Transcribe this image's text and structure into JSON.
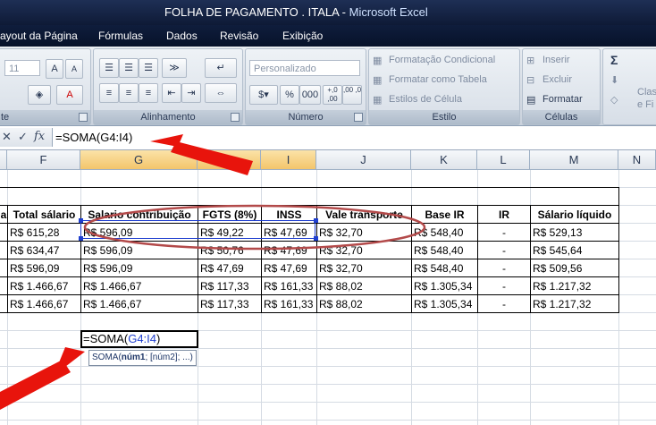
{
  "window": {
    "title": "FOLHA DE PAGAMENTO  . ITALA - ",
    "app": "Microsoft Excel"
  },
  "menu": [
    "ayout da Página",
    "Fórmulas",
    "Dados",
    "Revisão",
    "Exibição"
  ],
  "ribbon": {
    "font_group": {
      "label": "te",
      "size": "11",
      "grow": "A",
      "shrink": "A",
      "color_a": "A"
    },
    "alignment_group": {
      "label": "Alinhamento"
    },
    "number_group": {
      "label": "Número",
      "format": "Personalizado",
      "dec_inc": "+,0 ,00",
      "dec_dec": ",00 ,0"
    },
    "styles_group": {
      "label": "Estilo",
      "conditional": "Formatação Condicional",
      "table": "Formatar como Tabela",
      "cell_styles": "Estilos de Célula"
    },
    "cells_group": {
      "label": "Células",
      "insert": "Inserir",
      "delete": "Excluir",
      "format": "Formatar"
    },
    "editing_group": {
      "sigma": "Σ",
      "class": "Clas",
      "e_fi": "e Fi"
    }
  },
  "formula_bar": {
    "cancel": "✕",
    "enter": "✓",
    "fx": "fx",
    "formula": "=SOMA(G4:I4)"
  },
  "columns": [
    "F",
    "G",
    "H",
    "I",
    "J",
    "K",
    "L",
    "M",
    "N"
  ],
  "table": {
    "headers": [
      "a",
      "Total sálario",
      "Salario contribuição",
      "FGTS (8%)",
      "INSS",
      "Vale transporte",
      "Base IR",
      "IR",
      "Sálario líquido"
    ],
    "rows": [
      [
        "R$ 615,28",
        "R$ 596,09",
        "R$ 49,22",
        "R$ 47,69",
        "R$ 32,70",
        "R$ 548,40",
        "-",
        "R$ 529,13"
      ],
      [
        "R$ 634,47",
        "R$ 596,09",
        "R$ 50,76",
        "R$ 47,69",
        "R$ 32,70",
        "R$ 548,40",
        "-",
        "R$ 545,64"
      ],
      [
        "R$ 596,09",
        "R$ 596,09",
        "R$ 47,69",
        "R$ 47,69",
        "R$ 32,70",
        "R$ 548,40",
        "-",
        "R$ 509,56"
      ],
      [
        "R$ 1.466,67",
        "R$ 1.466,67",
        "R$ 117,33",
        "R$ 161,33",
        "R$ 88,02",
        "R$ 1.305,34",
        "-",
        "R$ 1.217,32"
      ],
      [
        "R$ 1.466,67",
        "R$ 1.466,67",
        "R$ 117,33",
        "R$ 161,33",
        "R$ 88,02",
        "R$ 1.305,34",
        "-",
        "R$ 1.217,32"
      ]
    ]
  },
  "edit_cell": {
    "prefix": "=SOMA(",
    "ref": "G4:I4",
    "suffix": ")"
  },
  "tooltip": {
    "fn": "SOMA(",
    "arg1": "núm1",
    "rest": "; [núm2]; ...)"
  },
  "colors": {
    "accent_red": "#e8140c",
    "ellipse": "#b34a4a",
    "ref_blue": "#1f3fcf"
  }
}
